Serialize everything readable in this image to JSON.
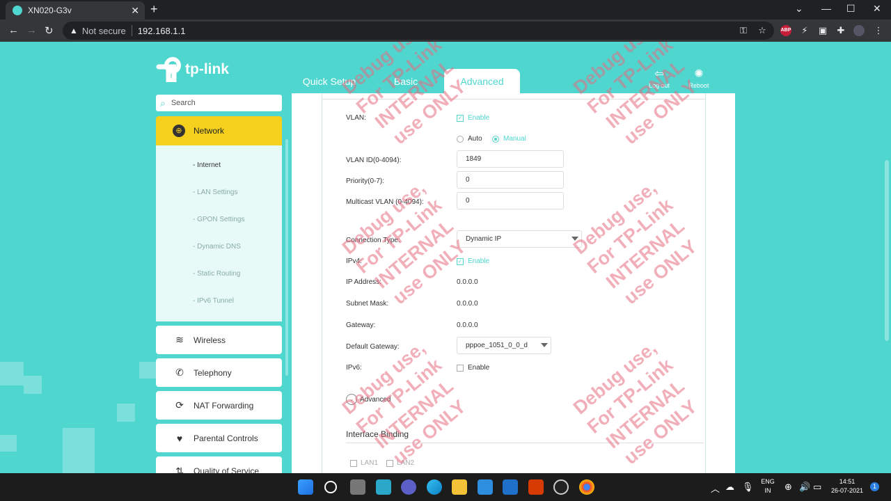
{
  "browser": {
    "tab_title": "XN020-G3v",
    "close": "✕",
    "new_tab": "+",
    "security": "Not secure",
    "url": "192.168.1.1",
    "abp_label": "ABP"
  },
  "brand": {
    "logo_text": "tp-link"
  },
  "topnav": {
    "quick_setup": "Quick Setup",
    "basic": "Basic",
    "advanced": "Advanced",
    "logout": "Log out",
    "reboot": "Reboot"
  },
  "search": {
    "placeholder": "Search"
  },
  "sidebar": {
    "network": "Network",
    "sub": [
      "- Internet",
      "- LAN Settings",
      "- GPON Settings",
      "- Dynamic DNS",
      "- Static Routing",
      "- IPv6 Tunnel"
    ],
    "items": [
      "Wireless",
      "Telephony",
      "NAT Forwarding",
      "Parental Controls",
      "Quality of Service"
    ]
  },
  "form": {
    "vlan_label": "VLAN:",
    "vlan_enable": "Enable",
    "auto": "Auto",
    "manual": "Manual",
    "vlan_id_label": "VLAN ID(0-4094):",
    "vlan_id": "1849",
    "priority_label": "Priority(0-7):",
    "priority": "0",
    "mcast_label": "Multicast VLAN (0-4094):",
    "mcast": "0",
    "conn_type_label": "Connection Type:",
    "conn_type": "Dynamic IP",
    "ipv4_label": "IPv4:",
    "ipv4_enable": "Enable",
    "ip_label": "IP Address:",
    "ip": "0.0.0.0",
    "mask_label": "Subnet Mask:",
    "mask": "0.0.0.0",
    "gw_label": "Gateway:",
    "gw": "0.0.0.0",
    "defgw_label": "Default Gateway:",
    "defgw": "pppoe_1051_0_0_d",
    "ipv6_label": "IPv6:",
    "ipv6_enable": "Enable",
    "advanced": "Advanced",
    "binding_title": "Interface Binding",
    "lan1": "LAN1",
    "lan2": "LAN2"
  },
  "watermark": {
    "line1": "Debug use,",
    "line2": "For TP-Link",
    "line3": "INTERNAL",
    "line4": "use ONLY"
  },
  "taskbar": {
    "lang1": "ENG",
    "lang2": "IN",
    "time": "14:51",
    "date": "26-07-2021"
  }
}
